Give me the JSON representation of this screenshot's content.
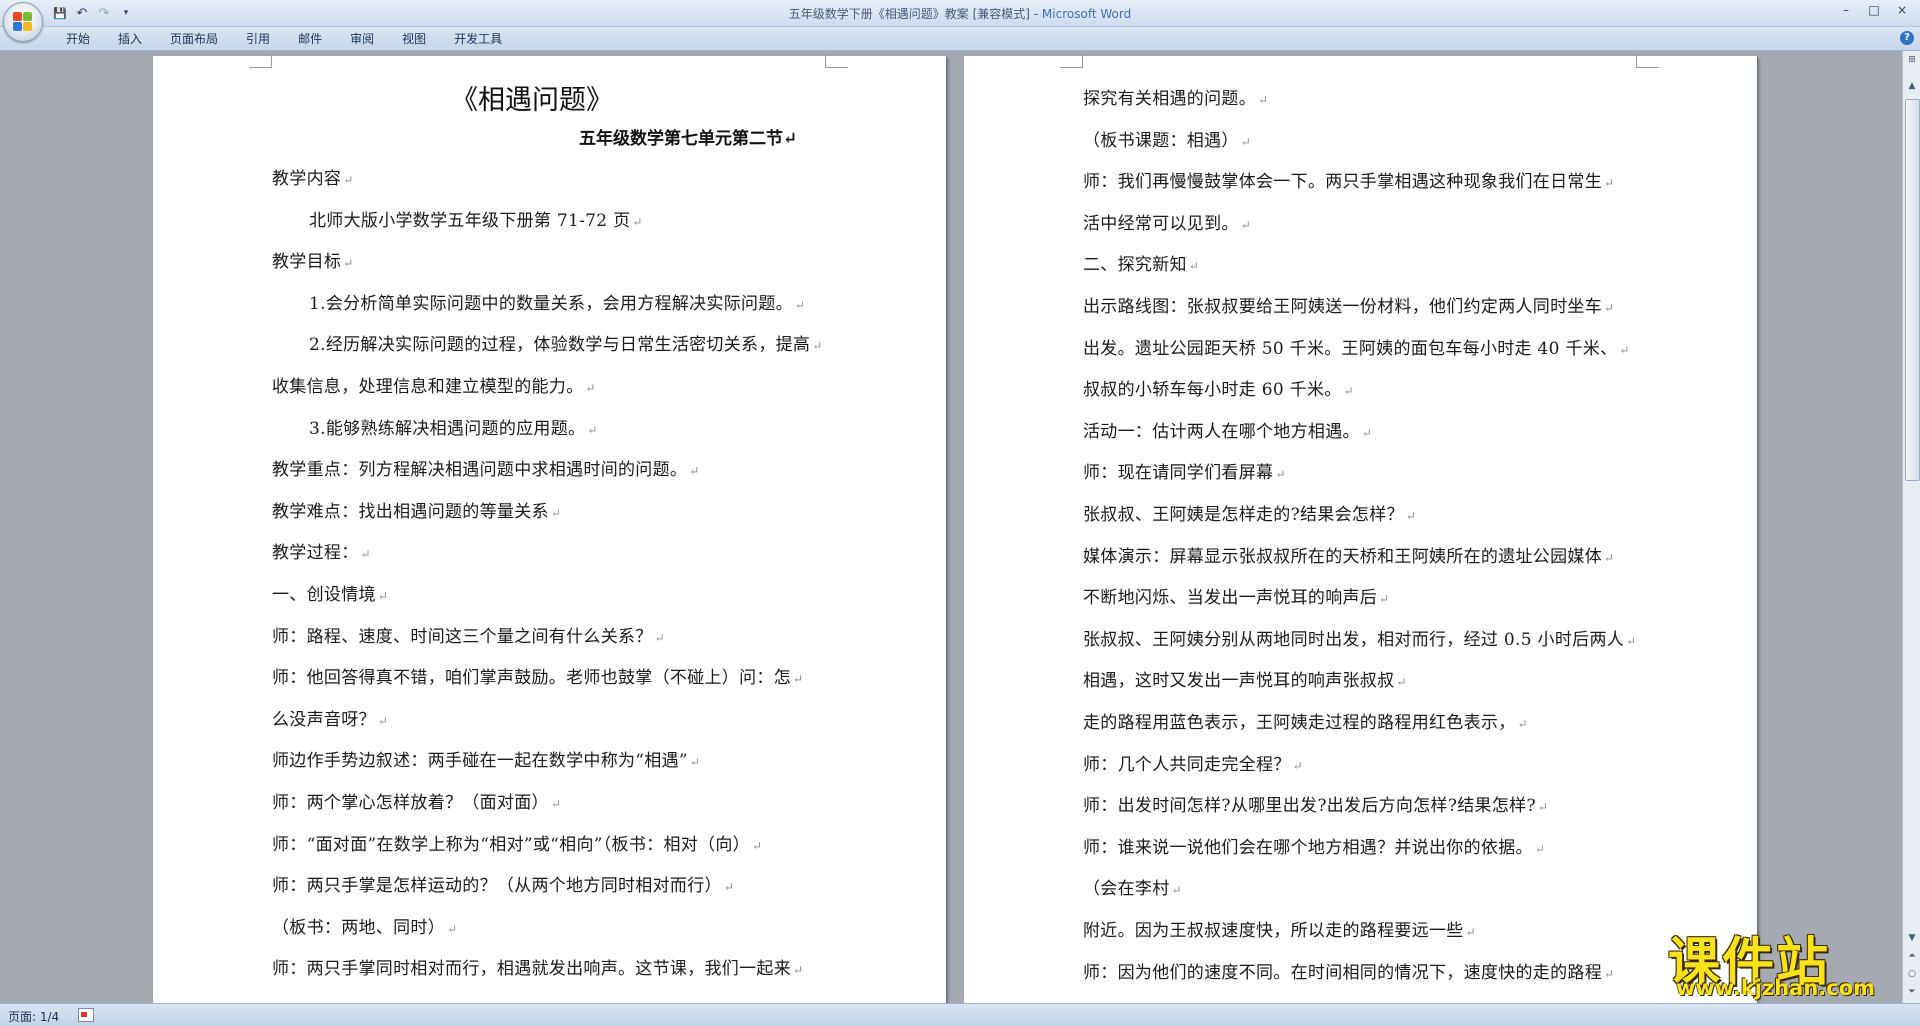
{
  "window": {
    "title_doc": "五年级数学下册《相遇问题》教案 [兼容模式] - ",
    "title_app": "Microsoft Word",
    "controls": [
      "–",
      "□",
      "×"
    ]
  },
  "ribbon": {
    "tabs": [
      "开始",
      "插入",
      "页面布局",
      "引用",
      "邮件",
      "审阅",
      "视图",
      "开发工具"
    ],
    "help": "?"
  },
  "quick_access": {
    "save": "💾",
    "undo": "↶",
    "redo": "↷",
    "customize": "▾"
  },
  "document": {
    "title": "《相遇问题》",
    "subtitle": "五年级数学第七单元第二节",
    "left_lines": [
      {
        "text": "教学内容",
        "indent": 0
      },
      {
        "text": "北师大版小学数学五年级下册第 71-72 页",
        "indent": 1
      },
      {
        "text": "教学目标",
        "indent": 0
      },
      {
        "text": "1.会分析简单实际问题中的数量关系，会用方程解决实际问题。",
        "indent": 1
      },
      {
        "text": "2.经历解决实际问题的过程，体验数学与日常生活密切关系，提高",
        "indent": 1
      },
      {
        "text": "收集信息，处理信息和建立模型的能力。",
        "indent": 0
      },
      {
        "text": "3.能够熟练解决相遇问题的应用题。",
        "indent": 1
      },
      {
        "text": "教学重点：列方程解决相遇问题中求相遇时间的问题。",
        "indent": 0
      },
      {
        "text": "教学难点：找出相遇问题的等量关系",
        "indent": 0
      },
      {
        "text": "教学过程：",
        "indent": 0
      },
      {
        "text": "一、创设情境",
        "indent": 0
      },
      {
        "text": "师：路程、速度、时间这三个量之间有什么关系？",
        "indent": 0
      },
      {
        "text": "师：他回答得真不错，咱们掌声鼓励。老师也鼓掌（不碰上）问：怎",
        "indent": 0
      },
      {
        "text": "么没声音呀？",
        "indent": 0
      },
      {
        "text": "师边作手势边叙述：两手碰在一起在数学中称为“相遇”",
        "indent": 0
      },
      {
        "text": "师：两个掌心怎样放着？（面对面）",
        "indent": 0
      },
      {
        "text": "师：“面对面”在数学上称为“相对”或“相向”（板书：相对（向）",
        "indent": 0
      },
      {
        "text": "师：两只手掌是怎样运动的？（从两个地方同时相对而行）",
        "indent": 0
      },
      {
        "text": "（板书：两地、同时）",
        "indent": 0
      },
      {
        "text": "师：两只手掌同时相对而行，相遇就发出响声。这节课，我们一起来",
        "indent": 0
      }
    ],
    "right_lines": [
      {
        "text": "探究有关相遇的问题。",
        "indent": 0
      },
      {
        "text": "（板书课题：相遇）",
        "indent": 0
      },
      {
        "text": "师：我们再慢慢鼓掌体会一下。两只手掌相遇这种现象我们在日常生",
        "indent": 0
      },
      {
        "text": "活中经常可以见到。",
        "indent": 0
      },
      {
        "text": "二、探究新知",
        "indent": 0
      },
      {
        "text": "出示路线图：张叔叔要给王阿姨送一份材料，他们约定两人同时坐车",
        "indent": 0
      },
      {
        "text": "出发。遗址公园距天桥 50 千米。王阿姨的面包车每小时走 40 千米、",
        "indent": 0
      },
      {
        "text": "叔叔的小轿车每小时走 60 千米。",
        "indent": 0
      },
      {
        "text": "活动一：估计两人在哪个地方相遇。",
        "indent": 0
      },
      {
        "text": "师：现在请同学们看屏幕",
        "indent": 0
      },
      {
        "text": "张叔叔、王阿姨是怎样走的?结果会怎样？",
        "indent": 0
      },
      {
        "text": "媒体演示：屏幕显示张叔叔所在的天桥和王阿姨所在的遗址公园媒体",
        "indent": 0
      },
      {
        "text": "不断地闪烁、当发出一声悦耳的响声后",
        "indent": 0
      },
      {
        "text": "张叔叔、王阿姨分别从两地同时出发，相对而行，经过 0.5 小时后两人",
        "indent": 0
      },
      {
        "text": "相遇，这时又发出一声悦耳的响声张叔叔",
        "indent": 0
      },
      {
        "text": "走的路程用蓝色表示，王阿姨走过程的路程用红色表示，",
        "indent": 0
      },
      {
        "text": "师：几个人共同走完全程？",
        "indent": 0
      },
      {
        "text": "师：出发时间怎样?从哪里出发?出发后方向怎样?结果怎样?",
        "indent": 0
      },
      {
        "text": "师：谁来说一说他们会在哪个地方相遇？并说出你的依据。",
        "indent": 0
      },
      {
        "text": "（会在李村",
        "indent": 0
      },
      {
        "text": "附近。因为王叔叔速度快，所以走的路程要远一些",
        "indent": 0
      },
      {
        "text": "师：因为他们的速度不同。在时间相同的情况下，速度快的走的路程",
        "indent": 0
      }
    ],
    "paragraph_mark": "↵"
  },
  "statusbar": {
    "page": "页面: 1/4"
  },
  "watermark": {
    "main": "课件站",
    "url": "www.kjzhan.com"
  },
  "colors": {
    "background": "#a4a9b2",
    "ribbon": "#c7d6ea",
    "watermark": "#f7e21c"
  }
}
